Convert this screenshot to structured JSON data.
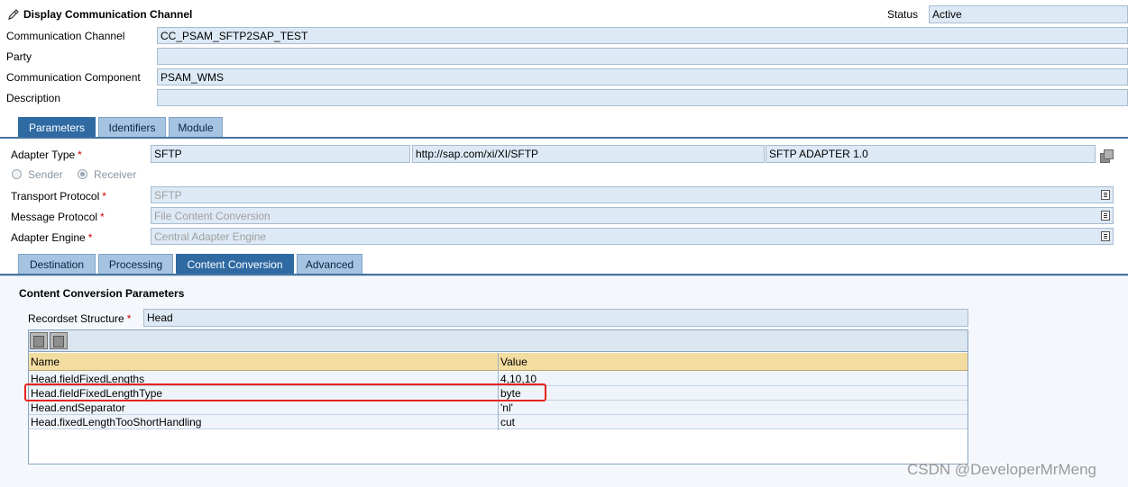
{
  "header": {
    "title": "Display Communication Channel",
    "status_label": "Status",
    "status_value": "Active"
  },
  "general": {
    "channel_label": "Communication Channel",
    "channel_value": "CC_PSAM_SFTP2SAP_TEST",
    "party_label": "Party",
    "party_value": "",
    "component_label": "Communication Component",
    "component_value": "PSAM_WMS",
    "description_label": "Description",
    "description_value": ""
  },
  "main_tabs": [
    {
      "label": "Parameters",
      "active": true
    },
    {
      "label": "Identifiers",
      "active": false
    },
    {
      "label": "Module",
      "active": false
    }
  ],
  "parameters": {
    "adapter_type_label": "Adapter Type",
    "adapter_type_name": "SFTP",
    "adapter_type_namespace": "http://sap.com/xi/XI/SFTP",
    "adapter_type_swcv": "SFTP ADAPTER 1.0",
    "sender_label": "Sender",
    "receiver_label": "Receiver",
    "direction_selected": "Receiver",
    "transport_protocol_label": "Transport Protocol",
    "transport_protocol_value": "SFTP",
    "message_protocol_label": "Message Protocol",
    "message_protocol_value": "File Content Conversion",
    "adapter_engine_label": "Adapter Engine",
    "adapter_engine_value": "Central Adapter Engine",
    "required_marker": "*"
  },
  "sub_tabs": [
    {
      "label": "Destination",
      "active": false
    },
    {
      "label": "Processing",
      "active": false
    },
    {
      "label": "Content Conversion",
      "active": true
    },
    {
      "label": "Advanced",
      "active": false
    }
  ],
  "content_conversion": {
    "section_title": "Content Conversion Parameters",
    "recordset_label": "Recordset Structure",
    "recordset_value": "Head",
    "table": {
      "columns": [
        "Name",
        "Value"
      ],
      "rows": [
        {
          "name": "Head.fieldFixedLengths",
          "value": "4,10,10"
        },
        {
          "name": "Head.fieldFixedLengthType",
          "value": "byte"
        },
        {
          "name": "Head.endSeparator",
          "value": "'nl'"
        },
        {
          "name": "Head.fixedLengthTooShortHandling",
          "value": "cut"
        }
      ],
      "highlighted_row": 1
    }
  },
  "watermark": "CSDN @DeveloperMrMeng",
  "colors": {
    "field_bg": "#dde9f5",
    "tab_active": "#2f6aa3",
    "tab_inactive": "#a6c4e2",
    "table_header": "#f3dca0",
    "highlight": "#e8231d",
    "required": "#d00000"
  }
}
